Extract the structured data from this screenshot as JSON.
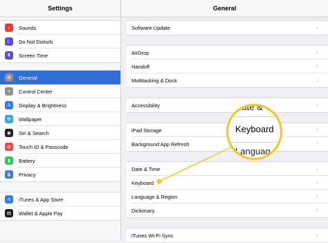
{
  "sidebar": {
    "title": "Settings",
    "groups": [
      [
        {
          "label": "Sounds",
          "icon": "speaker-icon",
          "color": "#e53b3b"
        },
        {
          "label": "Do Not Disturb",
          "icon": "moon-icon",
          "color": "#5b4fcf"
        },
        {
          "label": "Screen Time",
          "icon": "hourglass-icon",
          "color": "#5b4fcf"
        }
      ],
      [
        {
          "label": "General",
          "icon": "gear-icon",
          "color": "#8e8e93",
          "selected": true
        },
        {
          "label": "Control Center",
          "icon": "toggles-icon",
          "color": "#8e8e93"
        },
        {
          "label": "Display & Brightness",
          "icon": "text-size-icon",
          "color": "#2f7cf6"
        },
        {
          "label": "Wallpaper",
          "icon": "flower-icon",
          "color": "#35a7e0"
        },
        {
          "label": "Siri & Search",
          "icon": "siri-icon",
          "color": "#222222"
        },
        {
          "label": "Touch ID & Passcode",
          "icon": "fingerprint-icon",
          "color": "#e5484d"
        },
        {
          "label": "Battery",
          "icon": "battery-icon",
          "color": "#35c759"
        },
        {
          "label": "Privacy",
          "icon": "hand-icon",
          "color": "#2f7cf6"
        }
      ],
      [
        {
          "label": "iTunes & App Store",
          "icon": "app-store-icon",
          "color": "#2f7cf6"
        },
        {
          "label": "Wallet & Apple Pay",
          "icon": "wallet-icon",
          "color": "#1c1c1e"
        }
      ]
    ]
  },
  "main": {
    "title": "General",
    "groups": [
      [
        "Software Update"
      ],
      [
        "AirDrop",
        "Handoff",
        "Multitasking & Dock"
      ],
      [
        "Accessibility"
      ],
      [
        "iPad Storage",
        "Background App Refresh"
      ],
      [
        "Date & Time",
        "Keyboard",
        "Language & Region",
        "Dictionary"
      ],
      [
        "iTunes Wi-Fi Sync"
      ]
    ]
  },
  "callout": {
    "top": "Date & Ti",
    "main": "Keyboard",
    "bottom": "Languag",
    "color": "#f5c518"
  }
}
